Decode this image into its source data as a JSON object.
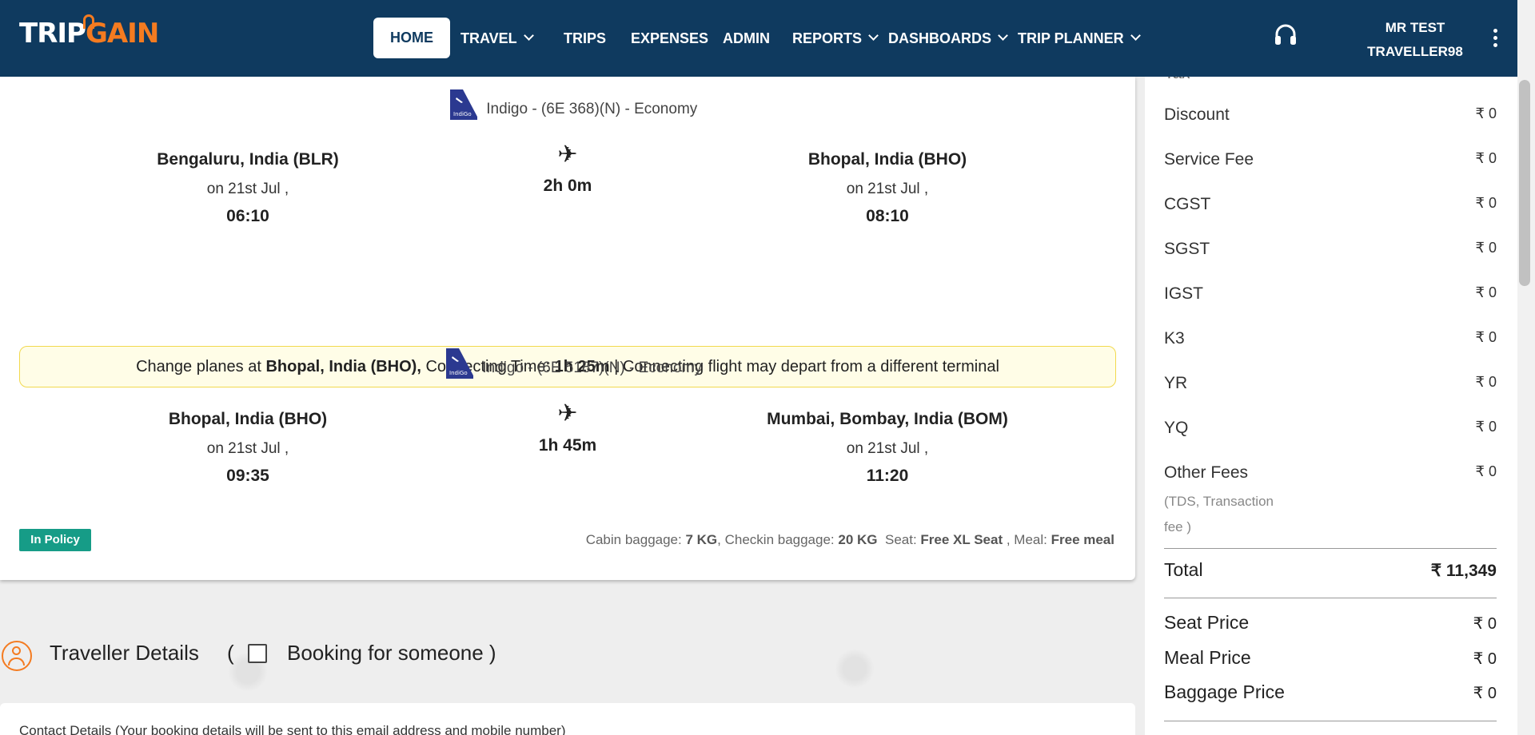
{
  "brand": {
    "trip": "TRIP",
    "gain": "GAIN"
  },
  "nav": {
    "home": "HOME",
    "travel": "TRAVEL",
    "trips": "TRIPS",
    "expenses": "EXPENSES",
    "admin": "ADMIN",
    "reports": "REPORTS",
    "dashboards": "DASHBOARDS",
    "trip_planner": "TRIP PLANNER"
  },
  "user": {
    "line1": "MR TEST",
    "line2": "TRAVELLER98"
  },
  "segments": [
    {
      "airline": "Indigo - (6E 368)(N) - Economy",
      "from_city": "Bengaluru, India (BLR)",
      "from_date": "on 21st Jul ,",
      "from_time": "06:10",
      "duration": "2h 0m",
      "to_city": "Bhopal, India (BHO)",
      "to_date": "on 21st Jul ,",
      "to_time": "08:10"
    },
    {
      "airline": "Indigo - (6E 5187)(N) - Economy",
      "from_city": "Bhopal, India (BHO)",
      "from_date": "on 21st Jul ,",
      "from_time": "09:35",
      "duration": "1h 45m",
      "to_city": "Mumbai, Bombay, India (BOM)",
      "to_date": "on 21st Jul ,",
      "to_time": "11:20"
    }
  ],
  "layover": {
    "prefix": "Change planes at",
    "city": "Bhopal, India (BHO),",
    "conn_label": "Connecting Time:",
    "conn_time": "1h 25m",
    "note": "| Connecting flight may depart from a different terminal"
  },
  "policy_badge": "In Policy",
  "baggage": {
    "cabin_label": "Cabin baggage:",
    "cabin_value": "7 KG",
    "checkin_label": ", Checkin baggage:",
    "checkin_value": "20 KG",
    "seat_label": "Seat:",
    "seat_value": "Free XL Seat",
    "meal_label": ", Meal:",
    "meal_value": "Free meal"
  },
  "traveller": {
    "title": "Traveller Details",
    "open_paren": "(",
    "booking_label": "Booking for someone )",
    "contact_text": "Contact Details (Your booking details will be sent to this email address and mobile number)"
  },
  "fare": {
    "rows": [
      {
        "label": "Discount",
        "value": "₹ 0"
      },
      {
        "label": "Service Fee",
        "value": "₹ 0"
      },
      {
        "label": "CGST",
        "value": "₹ 0"
      },
      {
        "label": "SGST",
        "value": "₹ 0"
      },
      {
        "label": "IGST",
        "value": "₹ 0"
      },
      {
        "label": "K3",
        "value": "₹ 0"
      },
      {
        "label": "YR",
        "value": "₹ 0"
      },
      {
        "label": "YQ",
        "value": "₹ 0"
      },
      {
        "label": "Other Fees",
        "value": "₹ 0"
      }
    ],
    "partial_top": "Tax",
    "other_fees_note": "(TDS, Transaction fee )",
    "total_label": "Total",
    "total_value": "₹ 11,349",
    "extras": [
      {
        "label": "Seat Price",
        "value": "₹ 0"
      },
      {
        "label": "Meal Price",
        "value": "₹ 0"
      },
      {
        "label": "Baggage Price",
        "value": "₹ 0"
      }
    ]
  },
  "colors": {
    "nav_bg": "#0f3a5f",
    "brand_orange": "#f47b20",
    "policy_green": "#169c87",
    "layover_bg": "#fffde7"
  },
  "icons": [
    "headset-icon",
    "kebab-menu-icon",
    "airplane-icon",
    "indigo-logo-icon",
    "user-circle-icon",
    "chevron-down-icon"
  ]
}
